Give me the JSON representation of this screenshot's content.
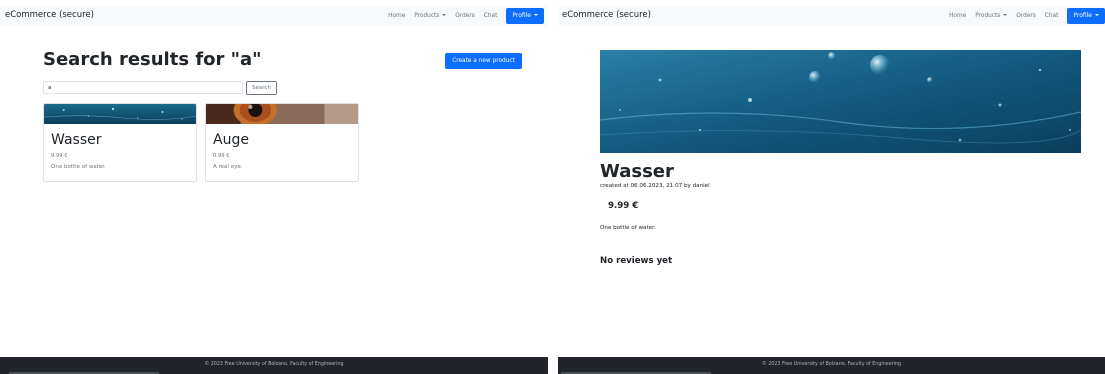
{
  "brand": "eCommerce (secure)",
  "nav": {
    "home": "Home",
    "products": "Products",
    "orders": "Orders",
    "chat": "Chat",
    "profile": "Profile"
  },
  "search": {
    "title": "Search results for \"a\"",
    "query": "a",
    "button": "Search",
    "create_button": "Create a new product"
  },
  "results": [
    {
      "name": "Wasser",
      "price": "9.99 €",
      "description": "One bottle of water."
    },
    {
      "name": "Auge",
      "price": "0.99 €",
      "description": "A real eye."
    }
  ],
  "product": {
    "name": "Wasser",
    "created": "created at 06.06.2023, 21:07 by daniel",
    "price": "9.99 €",
    "description": "One bottle of water.",
    "reviews": "No reviews yet"
  },
  "footer": "© 2023 Free University of Bolzano, Faculty of Engineering",
  "colors": {
    "primary": "#0d6efd",
    "navbar": "#f8f9fa",
    "footer": "#212529"
  }
}
